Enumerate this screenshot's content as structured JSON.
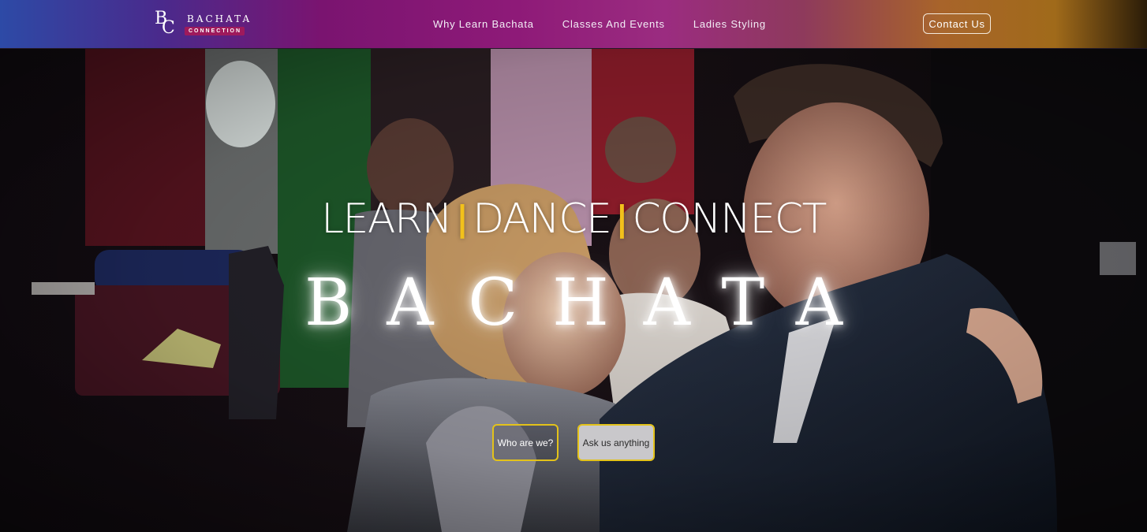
{
  "brand": {
    "mark_letter_1": "B",
    "mark_letter_2": "C",
    "title": "BACHATA",
    "subtitle": "CONNECTION",
    "subtitle_bg": "#9e1a5c"
  },
  "nav": {
    "items": [
      {
        "label": "Why Learn Bachata"
      },
      {
        "label": "Classes And Events"
      },
      {
        "label": "Ladies Styling"
      }
    ],
    "contact_label": "Contact Us"
  },
  "hero": {
    "tagline_words": [
      "LEARN",
      "DANCE",
      "CONNECT"
    ],
    "separator": "|",
    "separator_color": "#f2c11b",
    "title": "BACHATA",
    "cta_primary": "Who are we?",
    "cta_secondary": "Ask us anything",
    "cta_border_color": "#e3c21a"
  }
}
